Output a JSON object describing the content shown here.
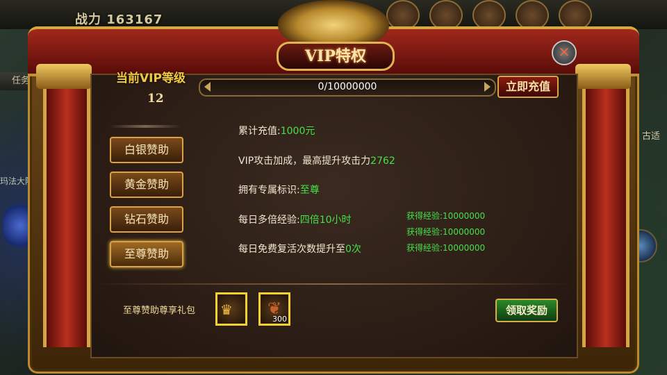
{
  "background": {
    "combat_power": "战力 163167",
    "task_tab": "任务",
    "side_text_right": "古适",
    "side_text_left": "玛法大陆",
    "top_right_label": ""
  },
  "window": {
    "title": "VIP特权",
    "close_icon": "close-icon"
  },
  "vip": {
    "level_title": "当前VIP等级",
    "level_number": "12",
    "progress_text": "0/10000000",
    "progress_fraction": 0,
    "recharge_label": "立即充值"
  },
  "sponsor_tabs": [
    {
      "label": "白银赞助"
    },
    {
      "label": "黄金赞助"
    },
    {
      "label": "钻石赞助"
    },
    {
      "label": "至尊赞助"
    }
  ],
  "info": {
    "line1_label": "累计充值:",
    "line1_value": "1000元",
    "line2_label": "VIP攻击加成，最高提升攻击力",
    "line2_value": "2762",
    "line3_label": "拥有专属标识:",
    "line3_value": "至尊",
    "line4_label": "每日多倍经验:",
    "line4_value": "四倍10小时",
    "line5_label": "每日免费复活次数提升至",
    "line5_value": "0次"
  },
  "exp_rewards": [
    "获得经验:10000000",
    "获得经验:10000000",
    "获得经验:10000000"
  ],
  "gift": {
    "label": "至尊赞助尊享礼包",
    "items": [
      {
        "icon": "crown-icon",
        "count": ""
      },
      {
        "icon": "horn-icon",
        "count": "300"
      }
    ],
    "claim_label": "领取奖励"
  },
  "colors": {
    "accent_gold": "#f2c842",
    "value_green": "#46e04a",
    "frame_red": "#a0281c"
  }
}
